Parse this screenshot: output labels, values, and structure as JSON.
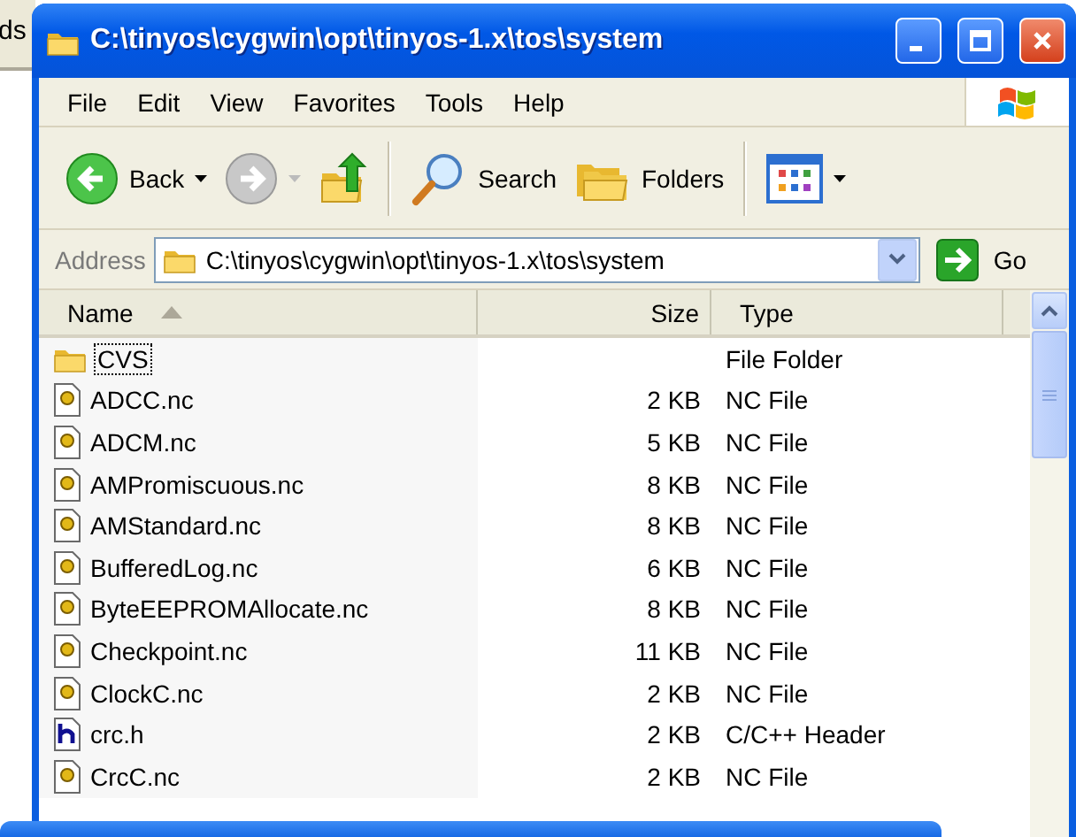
{
  "background_window": {
    "title_fragment": "ds"
  },
  "window": {
    "title": "C:\\tinyos\\cygwin\\opt\\tinyos-1.x\\tos\\system"
  },
  "menu": [
    "File",
    "Edit",
    "View",
    "Favorites",
    "Tools",
    "Help"
  ],
  "toolbar": [
    {
      "kind": "back",
      "label": "Back",
      "disabled": false,
      "dropdown": true
    },
    {
      "kind": "forward",
      "disabled": true,
      "dropdown": true
    },
    {
      "kind": "up"
    },
    {
      "kind": "search",
      "label": "Search"
    },
    {
      "kind": "folders",
      "label": "Folders"
    },
    {
      "kind": "views",
      "dropdown": true
    }
  ],
  "address": {
    "label": "Address",
    "value": "C:\\tinyos\\cygwin\\opt\\tinyos-1.x\\tos\\system",
    "go": "Go"
  },
  "columns": [
    {
      "label": "Name",
      "sorted": true
    },
    {
      "label": "Size",
      "sorted": false
    },
    {
      "label": "Type",
      "sorted": false
    }
  ],
  "rows": [
    {
      "kind": "folder",
      "name": "CVS",
      "type": "File Folder",
      "focused": true
    },
    {
      "kind": "nc",
      "name": "ADCC.nc",
      "size": "2 KB",
      "type": "NC File",
      "focused": false
    },
    {
      "kind": "nc",
      "name": "ADCM.nc",
      "size": "5 KB",
      "type": "NC File",
      "focused": false
    },
    {
      "kind": "nc",
      "name": "AMPromiscuous.nc",
      "size": "8 KB",
      "type": "NC File",
      "focused": false
    },
    {
      "kind": "nc",
      "name": "AMStandard.nc",
      "size": "8 KB",
      "type": "NC File",
      "focused": false
    },
    {
      "kind": "nc",
      "name": "BufferedLog.nc",
      "size": "6 KB",
      "type": "NC File",
      "focused": false
    },
    {
      "kind": "nc",
      "name": "ByteEEPROMAllocate.nc",
      "size": "8 KB",
      "type": "NC File",
      "focused": false
    },
    {
      "kind": "nc",
      "name": "Checkpoint.nc",
      "size": "11 KB",
      "type": "NC File",
      "focused": false
    },
    {
      "kind": "nc",
      "name": "ClockC.nc",
      "size": "2 KB",
      "type": "NC File",
      "focused": false
    },
    {
      "kind": "header",
      "name": "crc.h",
      "size": "2 KB",
      "type": "C/C++ Header",
      "focused": false
    },
    {
      "kind": "nc",
      "name": "CrcC.nc",
      "size": "2 KB",
      "type": "NC File",
      "focused": false
    }
  ]
}
